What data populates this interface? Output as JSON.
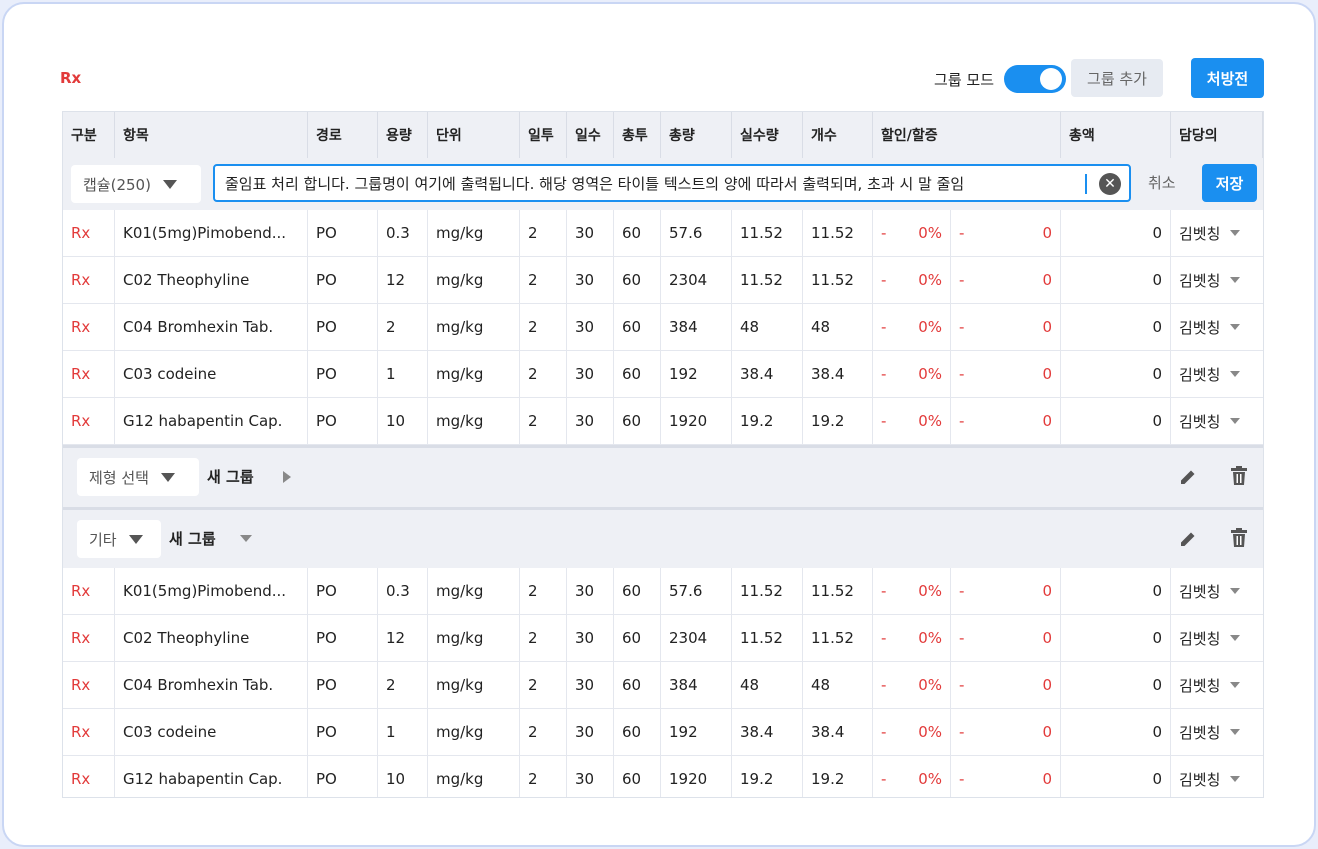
{
  "header": {
    "rx_title": "Rx",
    "group_mode_label": "그룹 모드",
    "group_mode_on": true,
    "group_add_label": "그룹 추가",
    "prescribe_label": "처방전"
  },
  "columns": [
    "구분",
    "항목",
    "경로",
    "용량",
    "단위",
    "일투",
    "일수",
    "총투",
    "총량",
    "실수량",
    "개수",
    "할인/할증",
    "총액",
    "담당의"
  ],
  "edit_row": {
    "form_select": "캡슐(250)",
    "group_input_value": "줄임표 처리 합니다. 그룹명이 여기에 출력됩니다. 해당 영역은 타이틀 텍스트의 양에 따라서 출력되며, 초과 시 말 줄임",
    "cancel_label": "취소",
    "save_label": "저장"
  },
  "group1_rows": [
    {
      "type": "Rx",
      "item": "K01(5mg)Pimobend...",
      "route": "PO",
      "dose": "0.3",
      "unit": "mg/kg",
      "daily": "2",
      "days": "30",
      "total_doses": "60",
      "total_amount": "57.6",
      "actual": "11.52",
      "count": "11.52",
      "disc_sign": "-",
      "disc_pct": "0%",
      "disc_sign2": "-",
      "disc_amt": "0",
      "total": "0",
      "doctor": "김벳칭"
    },
    {
      "type": "Rx",
      "item": "C02 Theophyline",
      "route": "PO",
      "dose": "12",
      "unit": "mg/kg",
      "daily": "2",
      "days": "30",
      "total_doses": "60",
      "total_amount": "2304",
      "actual": "11.52",
      "count": "11.52",
      "disc_sign": "-",
      "disc_pct": "0%",
      "disc_sign2": "-",
      "disc_amt": "0",
      "total": "0",
      "doctor": "김벳칭"
    },
    {
      "type": "Rx",
      "item": "C04 Bromhexin Tab.",
      "route": "PO",
      "dose": "2",
      "unit": "mg/kg",
      "daily": "2",
      "days": "30",
      "total_doses": "60",
      "total_amount": "384",
      "actual": "48",
      "count": "48",
      "disc_sign": "-",
      "disc_pct": "0%",
      "disc_sign2": "-",
      "disc_amt": "0",
      "total": "0",
      "doctor": "김벳칭"
    },
    {
      "type": "Rx",
      "item": "C03 codeine",
      "route": "PO",
      "dose": "1",
      "unit": "mg/kg",
      "daily": "2",
      "days": "30",
      "total_doses": "60",
      "total_amount": "192",
      "actual": "38.4",
      "count": "38.4",
      "disc_sign": "-",
      "disc_pct": "0%",
      "disc_sign2": "-",
      "disc_amt": "0",
      "total": "0",
      "doctor": "김벳칭"
    },
    {
      "type": "Rx",
      "item": "G12 habapentin Cap.",
      "route": "PO",
      "dose": "10",
      "unit": "mg/kg",
      "daily": "2",
      "days": "30",
      "total_doses": "60",
      "total_amount": "1920",
      "actual": "19.2",
      "count": "19.2",
      "disc_sign": "-",
      "disc_pct": "0%",
      "disc_sign2": "-",
      "disc_amt": "0",
      "total": "0",
      "doctor": "김벳칭"
    }
  ],
  "group2": {
    "form_select": "제형 선택",
    "name": "새 그룹",
    "expanded": false
  },
  "group3": {
    "form_select": "기타",
    "name": "새 그룹",
    "expanded": true
  },
  "group3_rows": [
    {
      "type": "Rx",
      "item": "K01(5mg)Pimobend...",
      "route": "PO",
      "dose": "0.3",
      "unit": "mg/kg",
      "daily": "2",
      "days": "30",
      "total_doses": "60",
      "total_amount": "57.6",
      "actual": "11.52",
      "count": "11.52",
      "disc_sign": "-",
      "disc_pct": "0%",
      "disc_sign2": "-",
      "disc_amt": "0",
      "total": "0",
      "doctor": "김벳칭"
    },
    {
      "type": "Rx",
      "item": "C02 Theophyline",
      "route": "PO",
      "dose": "12",
      "unit": "mg/kg",
      "daily": "2",
      "days": "30",
      "total_doses": "60",
      "total_amount": "2304",
      "actual": "11.52",
      "count": "11.52",
      "disc_sign": "-",
      "disc_pct": "0%",
      "disc_sign2": "-",
      "disc_amt": "0",
      "total": "0",
      "doctor": "김벳칭"
    },
    {
      "type": "Rx",
      "item": "C04 Bromhexin Tab.",
      "route": "PO",
      "dose": "2",
      "unit": "mg/kg",
      "daily": "2",
      "days": "30",
      "total_doses": "60",
      "total_amount": "384",
      "actual": "48",
      "count": "48",
      "disc_sign": "-",
      "disc_pct": "0%",
      "disc_sign2": "-",
      "disc_amt": "0",
      "total": "0",
      "doctor": "김벳칭"
    },
    {
      "type": "Rx",
      "item": "C03 codeine",
      "route": "PO",
      "dose": "1",
      "unit": "mg/kg",
      "daily": "2",
      "days": "30",
      "total_doses": "60",
      "total_amount": "192",
      "actual": "38.4",
      "count": "38.4",
      "disc_sign": "-",
      "disc_pct": "0%",
      "disc_sign2": "-",
      "disc_amt": "0",
      "total": "0",
      "doctor": "김벳칭"
    },
    {
      "type": "Rx",
      "item": "G12 habapentin Cap.",
      "route": "PO",
      "dose": "10",
      "unit": "mg/kg",
      "daily": "2",
      "days": "30",
      "total_doses": "60",
      "total_amount": "1920",
      "actual": "19.2",
      "count": "19.2",
      "disc_sign": "-",
      "disc_pct": "0%",
      "disc_sign2": "-",
      "disc_amt": "0",
      "total": "0",
      "doctor": "김벳칭"
    }
  ],
  "colors": {
    "accent": "#1a8ff0",
    "rx_red": "#e23a3a",
    "flag_green": "#18a23a"
  }
}
